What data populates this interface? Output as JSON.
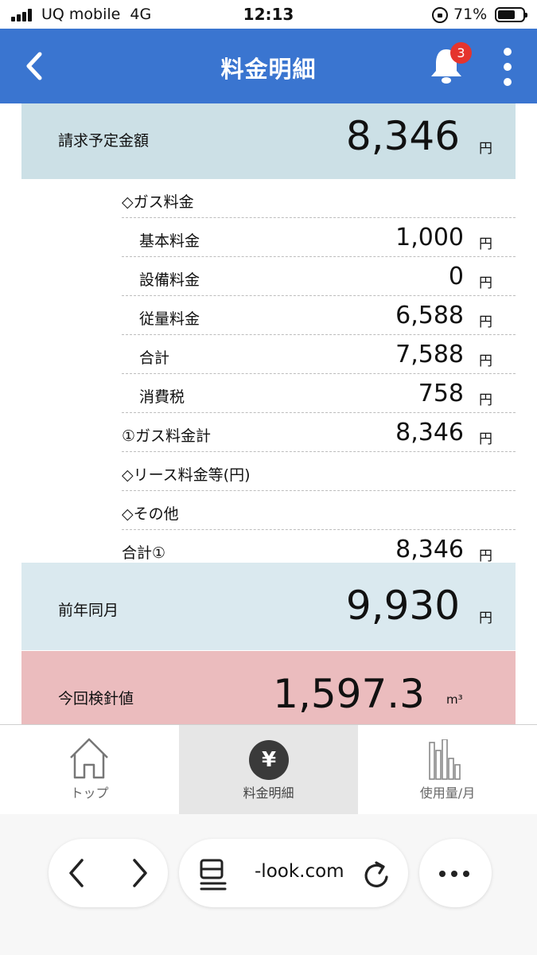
{
  "status_bar": {
    "carrier": "UQ mobile  4G",
    "time": "12:13",
    "battery": "71%",
    "battery_level": 0.71
  },
  "header": {
    "title": "料金明細",
    "notification_count": "3",
    "back_icon": "chevron-left-icon",
    "bell_icon": "bell-icon",
    "more_icon": "vertical-dots-icon"
  },
  "billing": {
    "label": "請求予定金額",
    "amount": "8,346",
    "unit": "円"
  },
  "breakdown": [
    {
      "label": "◇ガス料金",
      "value": "",
      "unit": "",
      "indent": false
    },
    {
      "label": "基本料金",
      "value": "1,000",
      "unit": "円",
      "indent": true
    },
    {
      "label": "設備料金",
      "value": "0",
      "unit": "円",
      "indent": true
    },
    {
      "label": "従量料金",
      "value": "6,588",
      "unit": "円",
      "indent": true
    },
    {
      "label": "合計",
      "value": "7,588",
      "unit": "円",
      "indent": true
    },
    {
      "label": "消費税",
      "value": "758",
      "unit": "円",
      "indent": true
    },
    {
      "label": "①ガス料金計",
      "value": "8,346",
      "unit": "円",
      "indent": false
    },
    {
      "label": "◇リース料金等(円)",
      "value": "",
      "unit": "",
      "indent": false
    },
    {
      "label": "◇その他",
      "value": "",
      "unit": "",
      "indent": false
    },
    {
      "label": "合計①",
      "value": "8,346",
      "unit": "円",
      "indent": false
    }
  ],
  "previous_year": {
    "label": "前年同月",
    "amount": "9,930",
    "unit": "円"
  },
  "meter_reading": {
    "label": "今回検針値",
    "amount": "1,597.3",
    "unit": "m³"
  },
  "tabs": [
    {
      "label": "トップ",
      "icon": "house-icon",
      "active": false
    },
    {
      "label": "料金明細",
      "icon": "yen-icon",
      "active": true
    },
    {
      "label": "使用量/月",
      "icon": "bar-chart-icon",
      "active": false
    }
  ],
  "browser": {
    "url": "-look.com",
    "back_icon": "chevron-left-icon",
    "forward_icon": "chevron-right-icon",
    "page_icon": "page-menu-icon",
    "reload_icon": "reload-icon",
    "more_icon": "ellipsis-icon"
  }
}
